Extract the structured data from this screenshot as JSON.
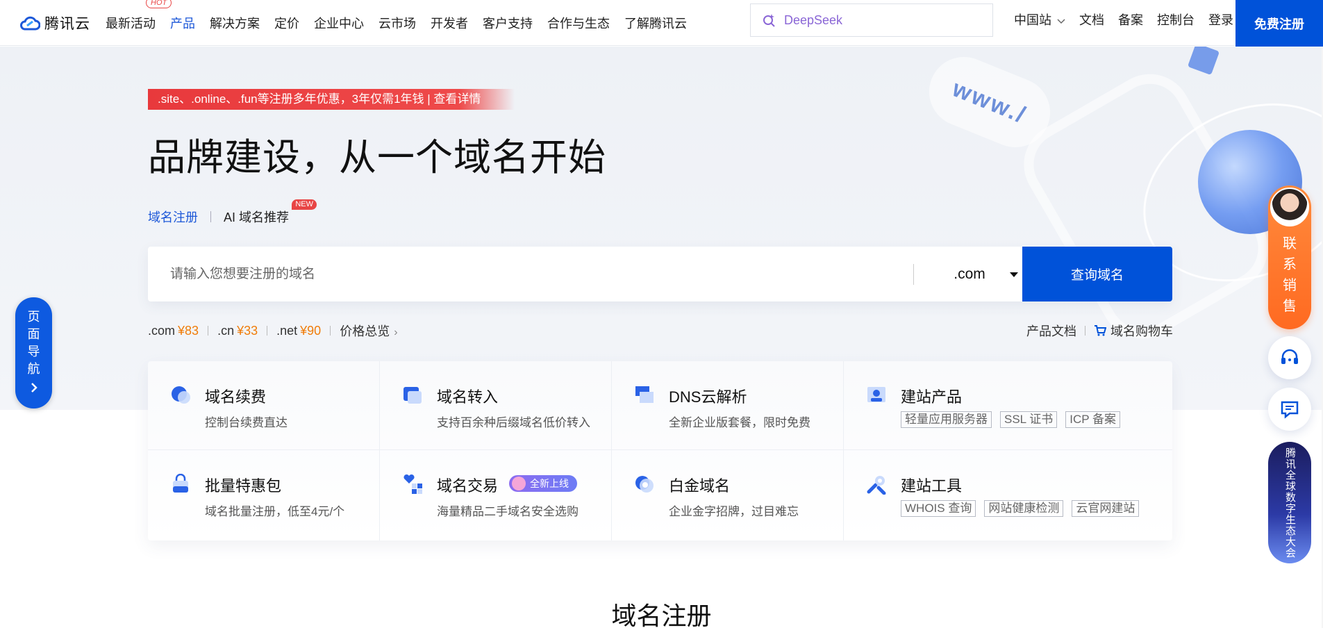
{
  "nav": {
    "logo_text": "腾讯云",
    "links": [
      {
        "label": "最新活动"
      },
      {
        "label": "产品"
      },
      {
        "label": "解决方案"
      },
      {
        "label": "定价"
      },
      {
        "label": "企业中心"
      },
      {
        "label": "云市场"
      },
      {
        "label": "开发者"
      },
      {
        "label": "客户支持"
      },
      {
        "label": "合作与生态"
      },
      {
        "label": "了解腾讯云"
      }
    ],
    "hot_badge": "HOT",
    "search_placeholder": "DeepSeek",
    "region": "中国站",
    "right_links": [
      "文档",
      "备案",
      "控制台",
      "登录"
    ],
    "register": "免费注册"
  },
  "hero": {
    "promo": ".site、.online、.fun等注册多年优惠，3年仅需1年钱 | 查看详情",
    "title": "品牌建设，从一个域名开始",
    "tab_register": "域名注册",
    "tab_ai": "AI 域名推荐",
    "new_badge": "NEW",
    "search_placeholder": "请输入您想要注册的域名",
    "tld_selected": ".com",
    "query_button": "查询域名",
    "deco_text": "www./",
    "prices": [
      {
        "tld": ".com",
        "price": "¥83"
      },
      {
        "tld": ".cn",
        "price": "¥33"
      },
      {
        "tld": ".net",
        "price": "¥90"
      }
    ],
    "price_overview": "价格总览",
    "product_docs": "产品文档",
    "cart": "域名购物车"
  },
  "features": {
    "renew": {
      "title": "域名续费",
      "sub": "控制台续费直达"
    },
    "transfer": {
      "title": "域名转入",
      "sub": "支持百余种后缀域名低价转入"
    },
    "dns": {
      "title": "DNS云解析",
      "sub": "全新企业版套餐，限时免费"
    },
    "site": {
      "title": "建站产品",
      "tags": [
        "轻量应用服务器",
        "SSL 证书",
        "ICP 备案"
      ]
    },
    "bulk": {
      "title": "批量特惠包",
      "sub": "域名批量注册，低至4元/个"
    },
    "trade": {
      "title": "域名交易",
      "badge": "全新上线",
      "sub": "海量精品二手域名安全选购"
    },
    "platinum": {
      "title": "白金域名",
      "sub": "企业金字招牌，过目难忘"
    },
    "tools": {
      "title": "建站工具",
      "tags": [
        "WHOIS 查询",
        "网站健康检测",
        "云官网建站"
      ]
    }
  },
  "side": {
    "page_nav": [
      "页",
      "面",
      "导",
      "航"
    ],
    "sales": [
      "联",
      "系",
      "销",
      "售"
    ],
    "event": "腾讯全球数字生态大会"
  },
  "section_title": "域名注册",
  "colors": {
    "primary": "#0052d9",
    "price_orange": "#f07c0a",
    "promo_red": "#e8393c",
    "sales_orange": "#ff6a21"
  }
}
